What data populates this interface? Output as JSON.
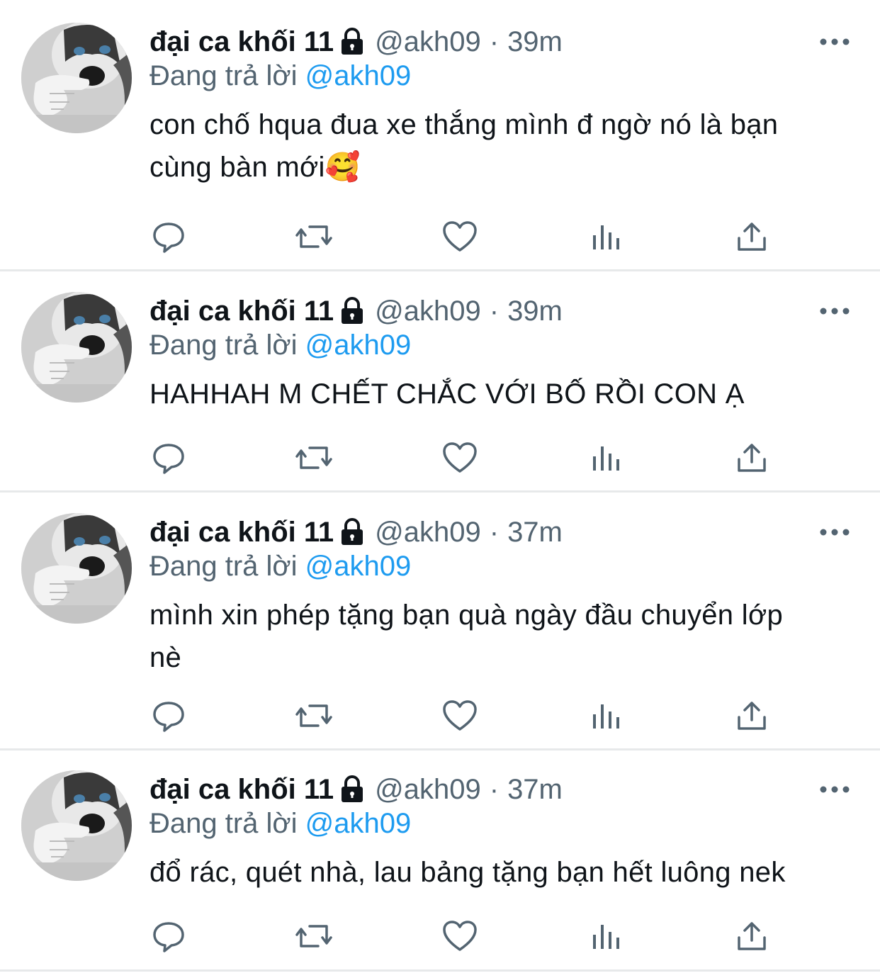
{
  "colors": {
    "text": "#0f1419",
    "secondary": "#536471",
    "accent": "#1d9bf0",
    "divider": "#e7e9ea",
    "icon": "#536471"
  },
  "tweets": [
    {
      "display_name": "đại ca khối 11",
      "handle": "@akh09",
      "separator": "·",
      "time": "39m",
      "replying_prefix": "Đang trả lời",
      "replying_to": "@akh09",
      "text_lines": [
        "con chố hqua đua xe thắng mình đ ngờ nó là bạn",
        "cùng bàn mới🥰"
      ],
      "locked_icon": "lock-icon",
      "actions": [
        "reply-icon",
        "retweet-icon",
        "like-icon",
        "analytics-icon",
        "share-icon"
      ]
    },
    {
      "display_name": "đại ca khối 11",
      "handle": "@akh09",
      "separator": "·",
      "time": "39m",
      "replying_prefix": "Đang trả lời",
      "replying_to": "@akh09",
      "text_lines": [
        "HAHHAH M CHẾT CHẮC VỚI BỐ RỒI CON Ạ"
      ],
      "locked_icon": "lock-icon",
      "actions": [
        "reply-icon",
        "retweet-icon",
        "like-icon",
        "analytics-icon",
        "share-icon"
      ]
    },
    {
      "display_name": "đại ca khối 11",
      "handle": "@akh09",
      "separator": "·",
      "time": "37m",
      "replying_prefix": "Đang trả lời",
      "replying_to": "@akh09",
      "text_lines": [
        "mình xin phép tặng bạn quà ngày đầu chuyển lớp",
        "nè"
      ],
      "locked_icon": "lock-icon",
      "actions": [
        "reply-icon",
        "retweet-icon",
        "like-icon",
        "analytics-icon",
        "share-icon"
      ]
    },
    {
      "display_name": "đại ca khối 11",
      "handle": "@akh09",
      "separator": "·",
      "time": "37m",
      "replying_prefix": "Đang trả lời",
      "replying_to": "@akh09",
      "text_lines": [
        "đổ rác, quét nhà, lau bảng tặng bạn hết luông nek"
      ],
      "locked_icon": "lock-icon",
      "actions": [
        "reply-icon",
        "retweet-icon",
        "like-icon",
        "analytics-icon",
        "share-icon"
      ]
    }
  ]
}
